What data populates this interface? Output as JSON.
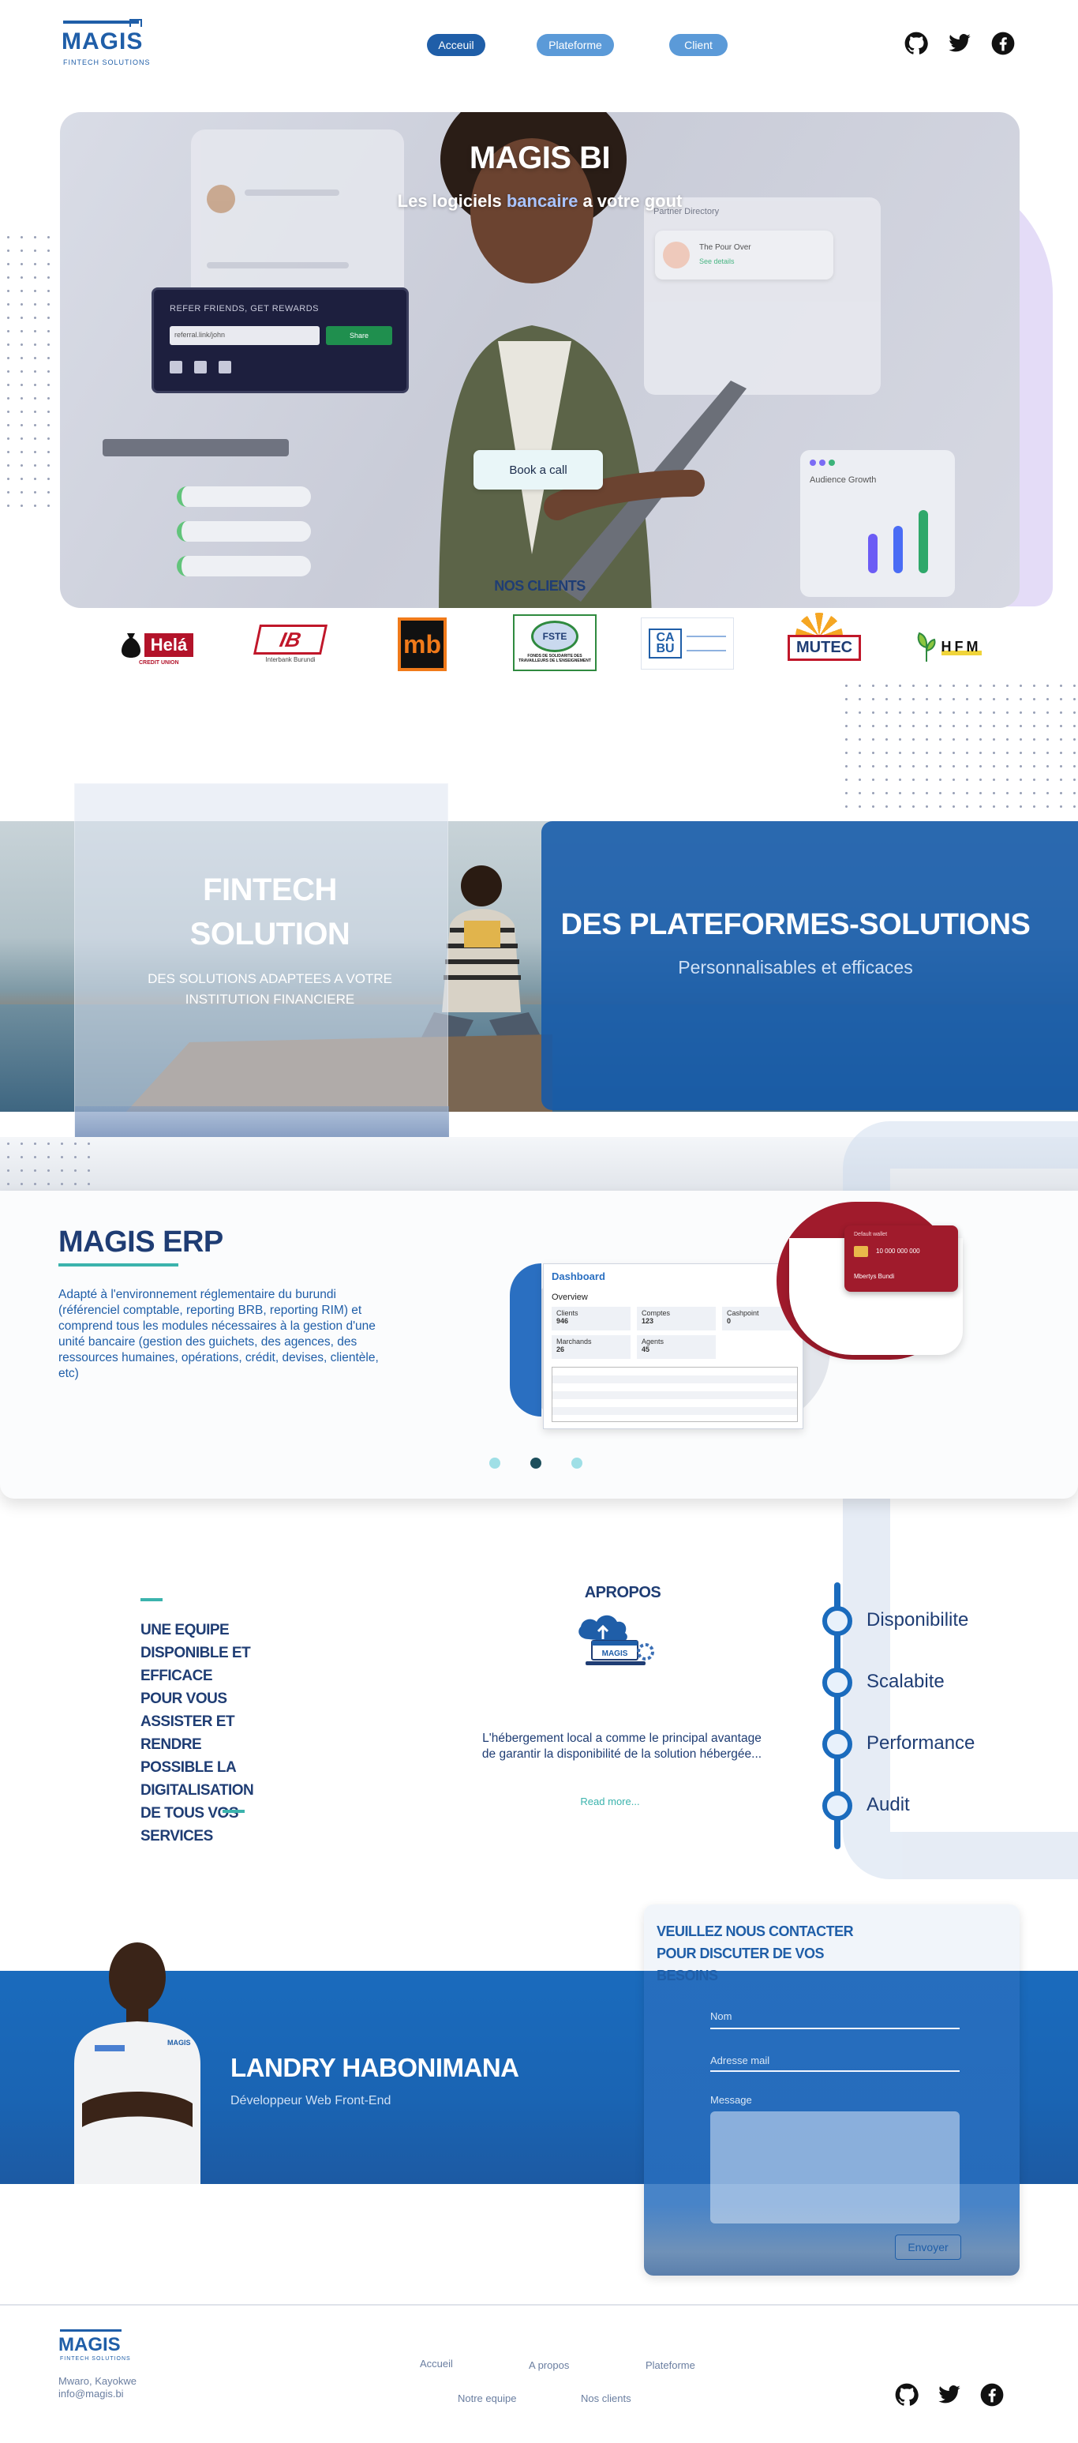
{
  "brand": {
    "name": "MAGIS",
    "tagline": "FINTECH SOLUTIONS"
  },
  "nav": {
    "items": [
      {
        "label": "Acceuil",
        "color": "#1f5ea8"
      },
      {
        "label": "Plateforme",
        "color": "#5b9ad8"
      },
      {
        "label": "Client",
        "color": "#5b9ad8"
      }
    ],
    "social_icons": [
      "github-icon",
      "twitter-icon",
      "facebook-icon"
    ]
  },
  "hero": {
    "title": "MAGIS BI",
    "subtitle_pre": "Les logiciels ",
    "subtitle_highlight": "bancaire",
    "subtitle_post": " a votre gout",
    "cta": "Book a call",
    "mock": {
      "referral_title": "REFER FRIENDS, GET REWARDS",
      "referral_input": "referral.link/john",
      "referral_button": "Share",
      "partner_dir": "Partner Directory",
      "partner_name": "The Pour Over",
      "partner_link": "See details",
      "growth_title": "Audience Growth"
    }
  },
  "clients": {
    "heading": "NOS CLIENTS",
    "logos": [
      {
        "name": "Helá",
        "sub": "CREDIT UNION"
      },
      {
        "name": "IB",
        "sub": "Interbank Burundi"
      },
      {
        "name": "mb",
        "sub": ""
      },
      {
        "name": "FSTE",
        "sub": "FONDS DE SOLIDARITE DES TRAVAILLEURS DE L'ENSEIGNEMENT"
      },
      {
        "name": "CA BU",
        "sub": ""
      },
      {
        "name": "MUTEC",
        "sub": ""
      },
      {
        "name": "HFM",
        "sub": ""
      }
    ]
  },
  "banner": {
    "left_title_1": "FINTECH",
    "left_title_2": "SOLUTION",
    "left_sub": "DES SOLUTIONS ADAPTEES A VOTRE INSTITUTION FINANCIERE",
    "right_title": "DES PLATEFORMES-SOLUTIONS",
    "right_sub": "Personnalisables et efficaces"
  },
  "erp": {
    "title": "MAGIS ERP",
    "desc": "Adapté à l'environnement réglementaire du burundi (référenciel comptable, reporting BRB, reporting RIM) et comprend tous les modules nécessaires à la gestion d'une unité bancaire (gestion des guichets, des agences, des ressources humaines, opérations, crédit, devises, clientèle, etc)",
    "dashboard": {
      "title": "Dashboard",
      "overview": "Overview",
      "stats": [
        {
          "label": "Clients",
          "value": "946"
        },
        {
          "label": "Comptes",
          "value": "123"
        },
        {
          "label": "Cashpoint",
          "value": "0"
        },
        {
          "label": "Marchands",
          "value": "26"
        },
        {
          "label": "Agents",
          "value": "45"
        }
      ],
      "card_number": "10 000 000 000",
      "card_name": "Mbertys Bundi",
      "card_label": "Default wallet"
    },
    "dots": 3,
    "active_dot": 1
  },
  "about": {
    "left_text": "UNE EQUIPE DISPONIBLE ET EFFICACE POUR VOUS ASSISTER ET RENDRE POSSIBLE LA DIGITALISATION DE TOUS VOS SERVICES",
    "apropos_title": "APROPOS",
    "apropos_text": "L'hébergement local a comme le principal avantage de garantir la disponibilité de la solution hébergée...",
    "read_more": "Read more...",
    "features": [
      "Disponibilite",
      "Scalabite",
      "Performance",
      "Audit"
    ]
  },
  "team": {
    "name": "LANDRY HABONIMANA",
    "role": "Développeur Web Front-End",
    "shirt_logo": "MAGIS"
  },
  "contact": {
    "title": "VEUILLEZ NOUS CONTACTER POUR DISCUTER DE VOS BESOINS",
    "name_label": "Nom",
    "email_label": "Adresse mail",
    "message_label": "Message",
    "submit": "Envoyer"
  },
  "footer": {
    "address": "Mwaro, Kayokwe",
    "email": "info@magis.bi",
    "links_row1": [
      "Accueil",
      "A propos",
      "Plateforme"
    ],
    "links_row2": [
      "Notre equipe",
      "Nos clients"
    ]
  },
  "colors": {
    "brand_blue": "#1f5ea8",
    "dark_navy": "#1f3d74",
    "accent_teal": "#3bb3ad",
    "highlight": "#a9c4ff"
  }
}
